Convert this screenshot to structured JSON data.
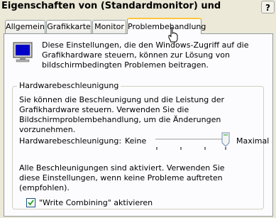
{
  "window": {
    "title": "Eigenschaften von (Standardmonitor) und",
    "help_label": "?"
  },
  "tabs": [
    {
      "label": "Allgemein"
    },
    {
      "label": "Grafikkarte"
    },
    {
      "label": "Monitor"
    },
    {
      "label": "Problembehandlung",
      "active": true
    }
  ],
  "intro": {
    "text": "Diese Einstellungen, die den Windows-Zugriff auf die Grafikhardware steuern, können zur Lösung von bildschirmbedingten Problemen beitragen.",
    "icon": "monitor-icon"
  },
  "hardware_group": {
    "legend": "Hardwarebeschleunigung",
    "description": "Sie können die Beschleunigung und die Leistung der Grafikhardware steuern. Verwenden Sie die Bildschirmproblembehandlung, um die Änderungen vorzunehmen.",
    "slider_label": "Hardwarebeschleunigung:",
    "slider_min_label": "Keine",
    "slider_max_label": "Maximal",
    "slider_level": 1.0,
    "status_text": "Alle Beschleunigungen sind aktiviert. Verwenden Sie diese Einstellungen, wenn keine Probleme auftreten (empfohlen).",
    "write_combining_label": "\"Write Combining\" aktivieren",
    "write_combining_checked": true
  },
  "colors": {
    "accent_tab": "#ffc83c",
    "panel_bg": "#fcfcfe",
    "window_bg": "#ece9d8"
  }
}
